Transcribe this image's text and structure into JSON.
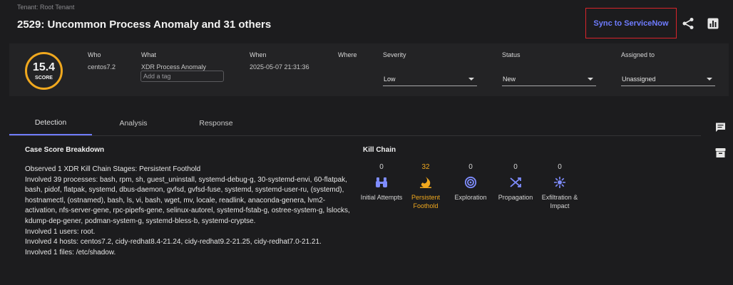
{
  "header": {
    "tenant": "Tenant: Root Tenant",
    "title": "2529: Uncommon Process Anomaly and 31 others",
    "sync_label": "Sync to ServiceNow"
  },
  "score": {
    "value": "15.4",
    "label": "SCORE",
    "color": "#f0a81e"
  },
  "fields": {
    "who_label": "Who",
    "who_value": "centos7.2",
    "what_label": "What",
    "what_value": "XDR Process Anomaly",
    "tag_placeholder": "Add a tag",
    "when_label": "When",
    "when_value": "2025-05-07 21:31:36",
    "where_label": "Where",
    "severity_label": "Severity",
    "severity_value": "Low",
    "status_label": "Status",
    "status_value": "New",
    "assigned_label": "Assigned to",
    "assigned_value": "Unassigned"
  },
  "tabs": [
    {
      "label": "Detection",
      "active": true
    },
    {
      "label": "Analysis",
      "active": false
    },
    {
      "label": "Response",
      "active": false
    }
  ],
  "breakdown": {
    "title": "Case Score Breakdown",
    "lines": [
      "Observed 1 XDR Kill Chain Stages: Persistent Foothold",
      "Involved 39 processes: bash, rpm, sh, guest_uninstall, systemd-debug-g, 30-systemd-envi, 60-flatpak, bash, pidof, flatpak, systemd, dbus-daemon, gvfsd, gvfsd-fuse, systemd, systemd-user-ru, (systemd), hostnamectl, (ostnamed), bash, ls, vi, bash, wget, mv, locale, readlink, anaconda-genera, lvm2-activation, nfs-server-gene, rpc-pipefs-gene, selinux-autorel, systemd-fstab-g, ostree-system-g, lslocks, kdump-dep-gener, podman-system-g, systemd-bless-b, systemd-cryptse.",
      "Involved 1 users: root.",
      "Involved 4 hosts: centos7.2, cidy-redhat8.4-21.24, cidy-redhat9.2-21.25, cidy-redhat7.0-21.21.",
      "Involved 1 files: /etc/shadow."
    ]
  },
  "kill_chain": {
    "title": "Kill Chain",
    "accent": "#f0a81e",
    "icon_color": "#7f8dff",
    "stages": [
      {
        "count": "0",
        "label": "Initial Attempts",
        "icon": "binoculars-icon"
      },
      {
        "count": "32",
        "label": "Persistent Foothold",
        "icon": "foothold-icon"
      },
      {
        "count": "0",
        "label": "Exploration",
        "icon": "target-icon"
      },
      {
        "count": "0",
        "label": "Propagation",
        "icon": "propagation-icon"
      },
      {
        "count": "0",
        "label": "Exfiltration & Impact",
        "icon": "explosion-icon"
      }
    ]
  }
}
